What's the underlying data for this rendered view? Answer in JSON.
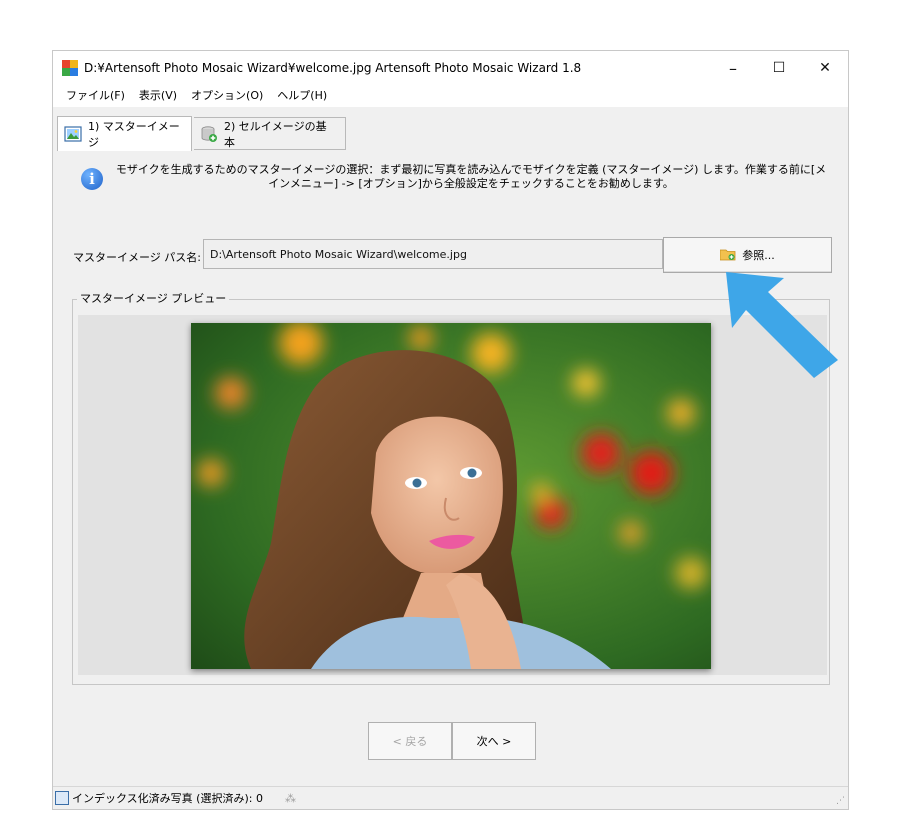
{
  "window": {
    "title": "D:¥Artensoft Photo Mosaic Wizard¥welcome.jpg Artensoft Photo Mosaic Wizard 1.8",
    "controls": {
      "minimize": "–",
      "maximize": "☐",
      "close": "✕"
    }
  },
  "menu": {
    "items": [
      {
        "label": "ファイル(F)"
      },
      {
        "label": "表示(V)"
      },
      {
        "label": "オプション(O)"
      },
      {
        "label": "ヘルプ(H)"
      }
    ]
  },
  "tabs": [
    {
      "label": "1) マスターイメージ",
      "active": true,
      "icon": "picture-icon"
    },
    {
      "label": "2) セルイメージの基本",
      "active": false,
      "icon": "database-add-icon"
    }
  ],
  "info": {
    "text": "モザイクを生成するためのマスターイメージの選択：まず最初に写真を読み込んでモザイクを定義 (マスターイメージ) します。作業する前に[メインメニュー] -> [オプション]から全般設定をチェックすることをお勧めします。"
  },
  "path": {
    "label": "マスターイメージ パス名:",
    "value": "D:\\Artensoft Photo Mosaic Wizard\\welcome.jpg"
  },
  "browse_button": {
    "label": "参照..."
  },
  "preview": {
    "legend": "マスターイメージ プレビュー"
  },
  "nav": {
    "back_label": "< 戻る",
    "next_label": "次へ >"
  },
  "status": {
    "text": "インデックス化済み写真 (選択済み): 0"
  },
  "colors": {
    "annotation_arrow": "#3ea6e8",
    "window_bg": "#f0f0f0"
  }
}
